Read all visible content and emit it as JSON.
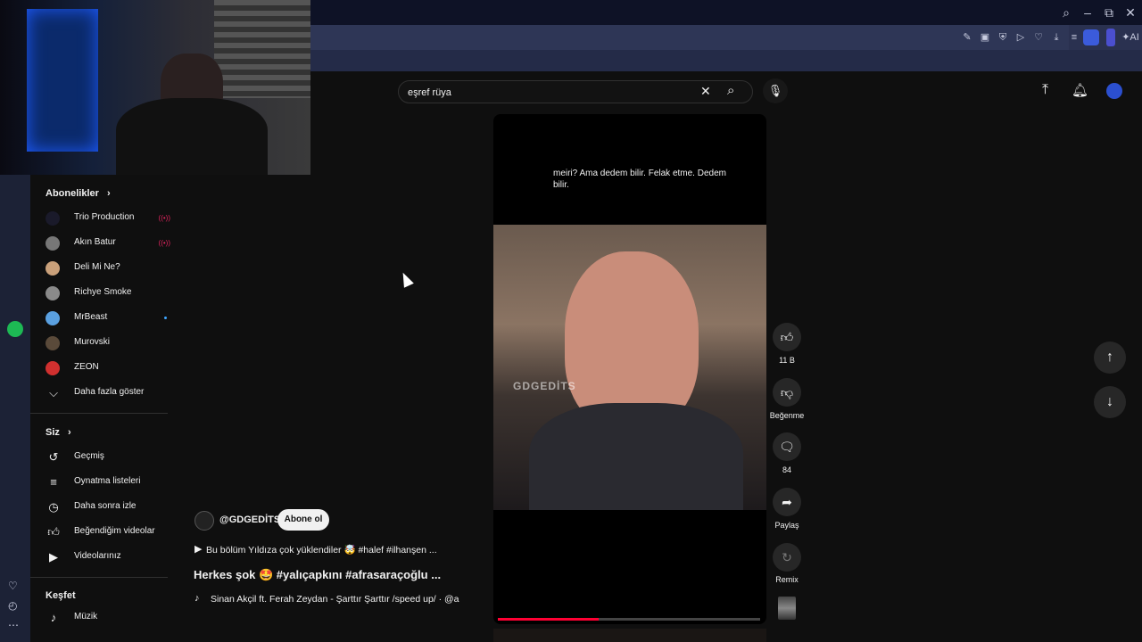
{
  "search": {
    "value": "eşref rüya"
  },
  "sidebar": {
    "subscriptions_title": "Abonelikler",
    "subscriptions": [
      {
        "name": "Trio Production",
        "live": true,
        "color": "#1a1a2a"
      },
      {
        "name": "Akın Batur",
        "live": true,
        "color": "#777777"
      },
      {
        "name": "Deli Mi Ne?",
        "live": false,
        "color": "#c9a07a"
      },
      {
        "name": "Richye Smoke",
        "live": false,
        "color": "#8a8a8a"
      },
      {
        "name": "MrBeast",
        "live": false,
        "dot": true,
        "color": "#5aa0e0"
      },
      {
        "name": "Murovski",
        "live": false,
        "color": "#5a4a3a"
      },
      {
        "name": "ZEON",
        "live": false,
        "color": "#d0302f"
      }
    ],
    "show_more": "Daha fazla göster",
    "you_title": "Siz",
    "you_items": [
      {
        "label": "Geçmiş",
        "icon": "history-icon"
      },
      {
        "label": "Oynatma listeleri",
        "icon": "playlist-icon"
      },
      {
        "label": "Daha sonra izle",
        "icon": "watch-later-icon"
      },
      {
        "label": "Beğendiğim videolar",
        "icon": "thumbs-up-icon"
      },
      {
        "label": "Videolarınız",
        "icon": "your-videos-icon"
      }
    ],
    "explore_title": "Keşfet",
    "explore_items": [
      {
        "label": "Müzik",
        "icon": "music-icon"
      }
    ]
  },
  "video": {
    "caption": "meiri? Ama dedem bilir. Felak etme. Dedem bilir.",
    "watermark": "GDGEDİTS",
    "progress": 0.385
  },
  "actions": {
    "likes": "11 B",
    "dislike": "Beğenme",
    "comments": "84",
    "share": "Paylaş",
    "remix": "Remix"
  },
  "overlay": {
    "channel": "@GDGEDİTS",
    "subscribe": "Abone ol",
    "pinned": "Bu bölüm Yıldıza çok yüklendiler 🤯 #halef #ilhanşen ...",
    "title": "Herkes şok 🤩 #yalıçapkını #afrasaraçoğlu ...",
    "music": "Sinan Akçil ft. Ferah Zeydan - Şarttır Şarttır /speed up/ · @a"
  },
  "colors": {
    "accent_red": "#ff0033",
    "spotify_green": "#1db954"
  }
}
